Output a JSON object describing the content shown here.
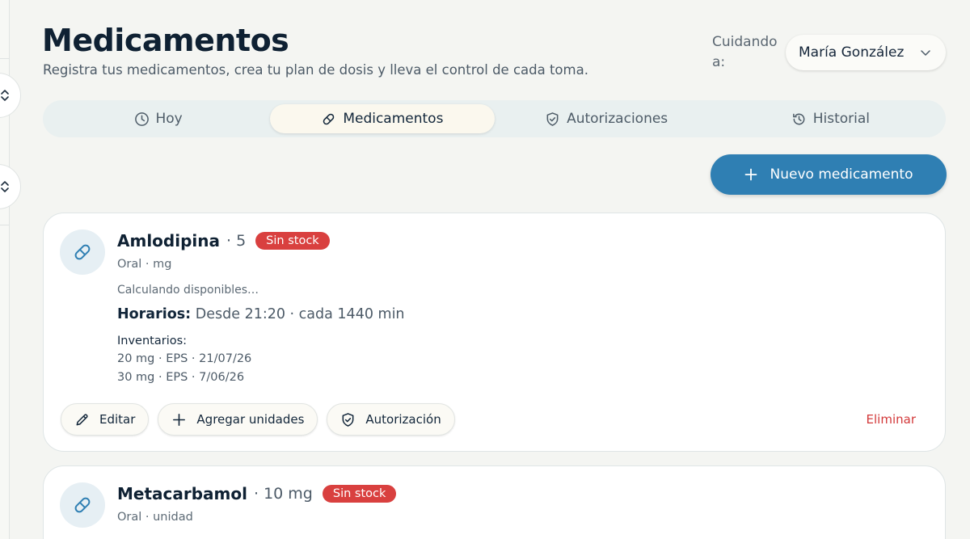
{
  "header": {
    "title": "Medicamentos",
    "subtitle": "Registra tus medicamentos, crea tu plan de dosis y lleva el control de cada toma.",
    "caring_label": "Cuidando a:",
    "patient": "María González"
  },
  "tabs": [
    {
      "label": "Hoy",
      "icon": "clock-icon",
      "active": false
    },
    {
      "label": "Medicamentos",
      "icon": "pill-icon",
      "active": true
    },
    {
      "label": "Autorizaciones",
      "icon": "shield-check-icon",
      "active": false
    },
    {
      "label": "Historial",
      "icon": "history-icon",
      "active": false
    }
  ],
  "new_button": {
    "label": "Nuevo medicamento",
    "icon": "plus-icon"
  },
  "medications": [
    {
      "name": "Amlodipina",
      "dose": "· 5",
      "status": "Sin stock",
      "route": "Oral · mg",
      "calc": "Calculando disponibles…",
      "schedule_label": "Horarios:",
      "schedule_value": "Desde 21:20 · cada 1440 min",
      "inventory_title": "Inventarios:",
      "inventory": [
        "20 mg · EPS · 21/07/26",
        "30 mg · EPS · 7/06/26"
      ],
      "actions": {
        "edit": "Editar",
        "add_units": "Agregar unidades",
        "authorization": "Autorización",
        "delete": "Eliminar"
      }
    },
    {
      "name": "Metacarbamol",
      "dose": "· 10 mg",
      "status": "Sin stock",
      "route": "Oral · unidad"
    }
  ],
  "colors": {
    "primary": "#2f7fb3",
    "danger": "#d9403f",
    "background": "#f4f5f2",
    "active_tab": "#fbf8ee"
  }
}
